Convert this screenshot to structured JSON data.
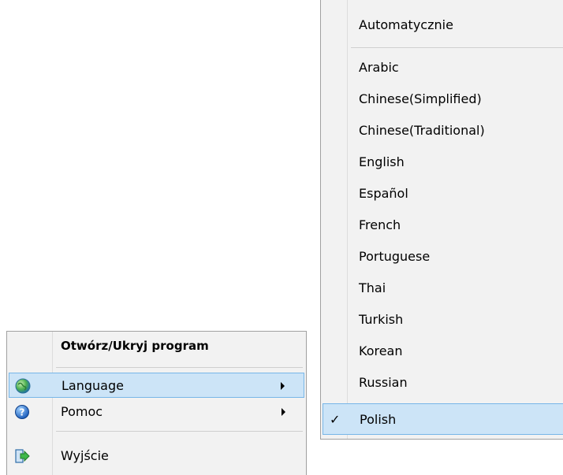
{
  "main_menu": {
    "items": [
      {
        "label": "Otwórz/Ukryj program",
        "bold": true
      },
      {
        "label": "Language",
        "icon": "globe-icon",
        "has_submenu": true,
        "highlighted": true
      },
      {
        "label": "Pomoc",
        "icon": "help-icon",
        "has_submenu": true
      },
      {
        "label": "Wyjście",
        "icon": "exit-icon"
      }
    ]
  },
  "language_submenu": {
    "items": [
      {
        "label": "Automatycznie"
      },
      {
        "label": "Arabic"
      },
      {
        "label": "Chinese(Simplified)"
      },
      {
        "label": "Chinese(Traditional)"
      },
      {
        "label": "English"
      },
      {
        "label": "Español"
      },
      {
        "label": "French"
      },
      {
        "label": "Portuguese"
      },
      {
        "label": "Thai"
      },
      {
        "label": "Turkish"
      },
      {
        "label": "Korean"
      },
      {
        "label": "Russian"
      },
      {
        "label": "Polish",
        "checked": true,
        "highlighted": true
      }
    ],
    "check_glyph": "✓"
  },
  "colors": {
    "menu_bg": "#f2f2f2",
    "highlight_bg": "#cce4f7",
    "highlight_border": "#77b6e8"
  }
}
